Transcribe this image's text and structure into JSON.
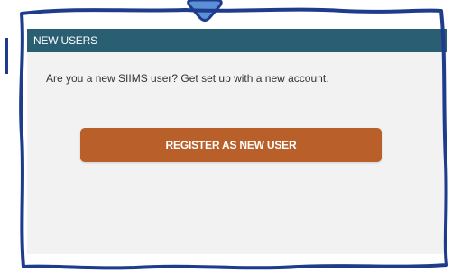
{
  "panel": {
    "title": "NEW USERS",
    "description": "Are you a new SIIMS user? Get set up with a new account.",
    "register_label": "REGISTER AS NEW USER"
  },
  "colors": {
    "header_bg": "#2a5e72",
    "panel_bg": "#f2f2f2",
    "button_bg": "#b95f2a",
    "annotation_border": "#1e3c8c",
    "pointer_fill": "#5b8fd6"
  }
}
